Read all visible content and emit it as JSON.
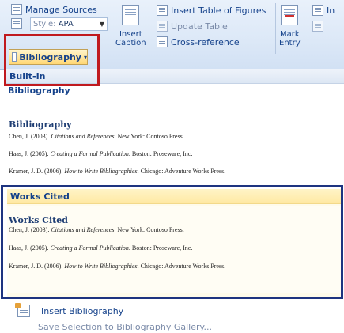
{
  "ribbon": {
    "manage_sources": "Manage Sources",
    "style_label": "Style:",
    "style_value": "APA",
    "bibliography_button": "Bibliography",
    "insert_caption_line1": "Insert",
    "insert_caption_line2": "Caption",
    "insert_table_of_figures": "Insert Table of Figures",
    "update_table": "Update Table",
    "cross_reference": "Cross-reference",
    "mark_entry_line1": "Mark",
    "mark_entry_line2": "Entry",
    "clipped_label": "In"
  },
  "gallery": {
    "builtin_header": "Built-In",
    "bibliography_item": {
      "header": "Bibliography",
      "title": "Bibliography",
      "entries": [
        {
          "prefix": "Chen, J. (2003). ",
          "work": "Citations and References",
          "suffix": ". New York: Contoso Press."
        },
        {
          "prefix": "Haas, J. (2005). ",
          "work": "Creating a Formal Publication",
          "suffix": ". Boston: Proseware, Inc."
        },
        {
          "prefix": "Kramer, J. D. (2006). ",
          "work": "How to Write Bibliographies",
          "suffix": ". Chicago: Adventure Works Press."
        }
      ]
    },
    "works_cited_item": {
      "header": "Works Cited",
      "title": "Works Cited",
      "entries": [
        {
          "prefix": "Chen, J. (2003). ",
          "work": "Citations and References",
          "suffix": ". New York: Contoso Press."
        },
        {
          "prefix": "Haas, J. (2005). ",
          "work": "Creating a Formal Publication",
          "suffix": ". Boston: Proseware, Inc."
        },
        {
          "prefix": "Kramer, J. D. (2006). ",
          "work": "How to Write Bibliographies",
          "suffix": ". Chicago: Adventure Works Press."
        }
      ]
    },
    "insert_bibliography": "Insert Bibliography",
    "save_selection": "Save Selection to Bibliography Gallery..."
  },
  "colors": {
    "highlight_red": "#c01a1f",
    "highlight_blue": "#1e3480",
    "ribbon_text": "#15428b"
  }
}
